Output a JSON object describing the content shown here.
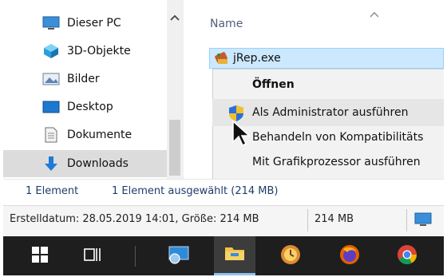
{
  "explorer": {
    "nav_items": [
      {
        "label": "Dieser PC",
        "icon": "computer-icon"
      },
      {
        "label": "3D-Objekte",
        "icon": "cube-3d-icon"
      },
      {
        "label": "Bilder",
        "icon": "pictures-icon"
      },
      {
        "label": "Desktop",
        "icon": "desktop-icon"
      },
      {
        "label": "Dokumente",
        "icon": "document-icon"
      },
      {
        "label": "Downloads",
        "icon": "download-arrow-icon"
      }
    ],
    "column_header": "Name",
    "file": {
      "name": "jRep.exe",
      "icon": "exe-app-icon"
    },
    "context_menu": [
      {
        "label": "Öffnen",
        "bold": true
      },
      {
        "label": "Als Administrator ausführen",
        "icon": "uac-shield-icon"
      },
      {
        "label": "Behandeln von Kompatibilitäts"
      },
      {
        "label": "Mit Grafikprozessor ausführen"
      }
    ],
    "status_count": "1 Element",
    "status_selected": "1 Element ausgewählt (214 MB)",
    "details_info": "Erstelldatum: 28.05.2019 14:01, Größe: 214 MB",
    "details_size": "214 MB"
  },
  "taskbar": {
    "items": [
      "start-button",
      "task-view-button",
      "network-app",
      "file-explorer",
      "clock-app",
      "firefox",
      "chrome"
    ]
  },
  "colors": {
    "taskbar_bg": "#1e1e1e",
    "selection": "#cce8ff",
    "active_taskbar": "#3c3c3c"
  }
}
